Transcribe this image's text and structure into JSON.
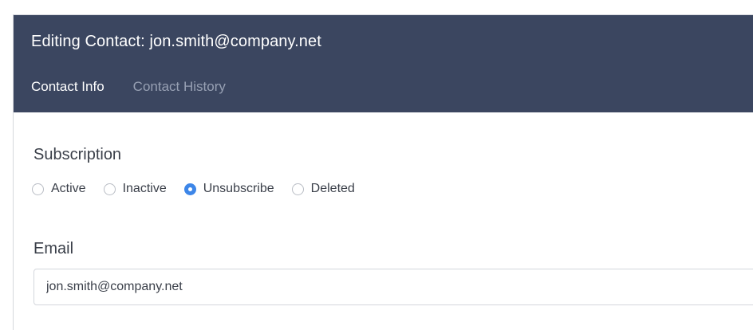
{
  "header": {
    "title": "Editing Contact: jon.smith@company.net",
    "background_color": "#3b4660"
  },
  "tabs": [
    {
      "label": "Contact Info",
      "active": true
    },
    {
      "label": "Contact History",
      "active": false
    }
  ],
  "subscription": {
    "label": "Subscription",
    "options": [
      {
        "label": "Active",
        "checked": false
      },
      {
        "label": "Inactive",
        "checked": false
      },
      {
        "label": "Unsubscribe",
        "checked": true
      },
      {
        "label": "Deleted",
        "checked": false
      }
    ],
    "accent_color": "#3d86e8"
  },
  "email": {
    "label": "Email",
    "value": "jon.smith@company.net"
  }
}
